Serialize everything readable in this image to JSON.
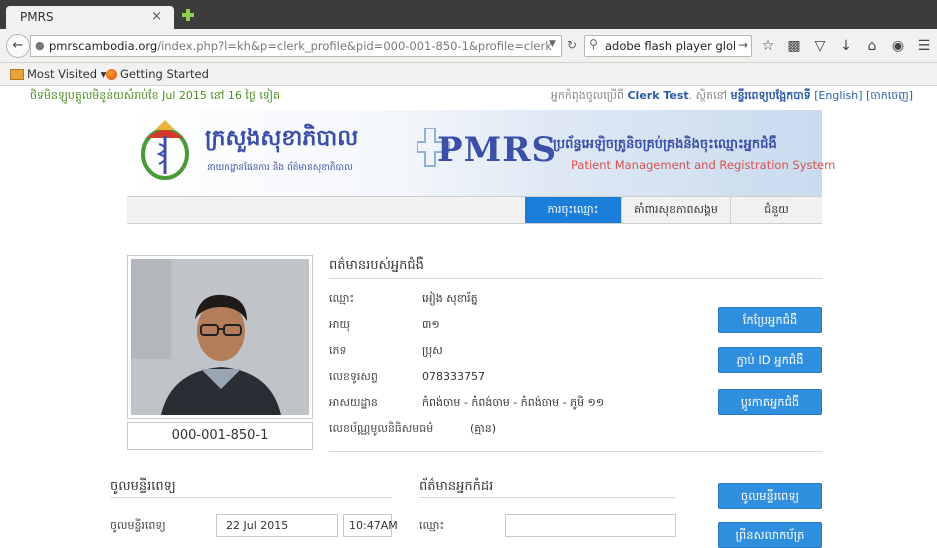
{
  "browser": {
    "tab_title": "PMRS",
    "tab_close": "×",
    "url_host": "pmrscambodia.org",
    "url_path": "/index.php?l=kh&p=clerk_profile&pid=000-001-850-1&profile=clerk",
    "search_text": "adobe flash player globle pri",
    "bookmarks": [
      "Most Visited ▾",
      "Getting Started"
    ]
  },
  "topinfo": {
    "left": "ថិទមិនឡូបត្តូលមិនូន់យសំរាប់ខែ Jul 2015 នៅ 16 ថ្ងៃ ទៀត",
    "right_prefix": "អ្នកកំពុងចូលប្រើពី",
    "user": "Clerk Test",
    "right_mid": ". ស្ថិតនៅ",
    "hospital": "មន្ទីរពេទ្យបង្អែកបាទី",
    "lang": "[English]",
    "logout": "[ចាកចេញ]"
  },
  "banner": {
    "ministry_title": "ក្រសួងសុខាភិបាល",
    "ministry_sub": "នាយកដ្ឋានផែនការ និង ព័ត៌មានសុខាភិបាល",
    "pmrs": "PMRS",
    "system_title_km": "ប្រព័ន្ធអេឡិចត្រូនិចគ្រប់គ្រងនិងចុះឈ្មោះអ្នកជំងឺ",
    "system_title_en": "Patient Management and Registration System"
  },
  "menu": [
    {
      "label": "ការចុះឈ្មោះ",
      "active": true
    },
    {
      "label": "គាំពារសុខភាពសង្គម",
      "active": false
    },
    {
      "label": "ជំនួយ",
      "active": false
    }
  ],
  "profile": {
    "patient_id": "000-001-850-1",
    "section_title": "ពត៌មានរបស់អ្នកជំងឺ",
    "fields": [
      {
        "label": "ឈ្មោះ",
        "value": "អៀង សុខារ័ត្ន"
      },
      {
        "label": "អាយុ",
        "value": "៣១"
      },
      {
        "label": "ភេទ",
        "value": "ប្រុស"
      },
      {
        "label": "លេខទូរសព្ទ",
        "value": "078333757"
      },
      {
        "label": "អាសយដ្ឋាន",
        "value": "កំពង់ចាម - កំពង់ចាម - កំពង់ចាម - ភូមិ ១១"
      },
      {
        "label": "លេខប័ណ្ណមូលនិធិសមធម៌",
        "value": "(គ្មាន)"
      }
    ],
    "buttons": [
      "កែប្រែអ្នកជំងឺ",
      "ភ្ជាប់ ID អ្នកជំងឺ",
      "ប្តូរកាតអ្នកជំងឺ"
    ]
  },
  "admission": {
    "section_title": "ចូលមន្ទីរពេទ្យ",
    "row_label": "ចូលមន្ទីរពេទ្យ",
    "date": "22 Jul 2015",
    "time": "10:47AM"
  },
  "referrer": {
    "section_title": "ព័ត៌មានអ្នកកំដរ",
    "name_label": "ឈ្មោះ",
    "name_value": ""
  },
  "actions": [
    "ចូលមន្ទីរពេទ្យ",
    "ព្រីនសលាកប័ត្រ"
  ]
}
